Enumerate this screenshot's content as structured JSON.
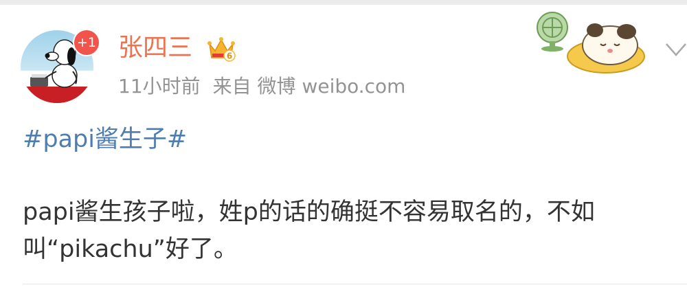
{
  "post": {
    "avatar_badge": "+1",
    "username": "张四三",
    "crown_level": "6",
    "timestamp": "11小时前",
    "source": "来自 微博 weibo.com",
    "topic": "#papi酱生子#",
    "text": "papi酱生孩子啦，姓p的话的确挺不容易取名的，不如叫“pikachu”好了。"
  },
  "colors": {
    "username": "#eb7350",
    "topic": "#507daf",
    "badge": "#f0544a",
    "meta": "#939393"
  }
}
